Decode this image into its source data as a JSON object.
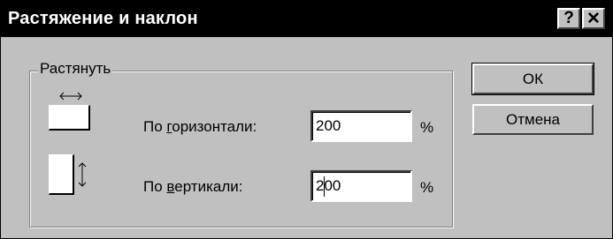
{
  "window": {
    "title": "Растяжение и наклон",
    "help_glyph": "?",
    "close_glyph": "✕"
  },
  "group": {
    "legend": "Растянуть",
    "horizontal": {
      "label_prefix": "По ",
      "label_mnemonic": "г",
      "label_rest": "оризонтали:",
      "value": "200",
      "unit": "%",
      "icon": "horizontal-stretch-icon"
    },
    "vertical": {
      "label_prefix": "По ",
      "label_mnemonic": "в",
      "label_rest": "ертикали:",
      "value": "200",
      "unit": "%",
      "icon": "vertical-stretch-icon"
    }
  },
  "buttons": {
    "ok": "ОК",
    "cancel": "Отмена"
  },
  "colors": {
    "face": "#c0c0c0",
    "titlebar": "#000000",
    "title_text": "#ffffff"
  }
}
